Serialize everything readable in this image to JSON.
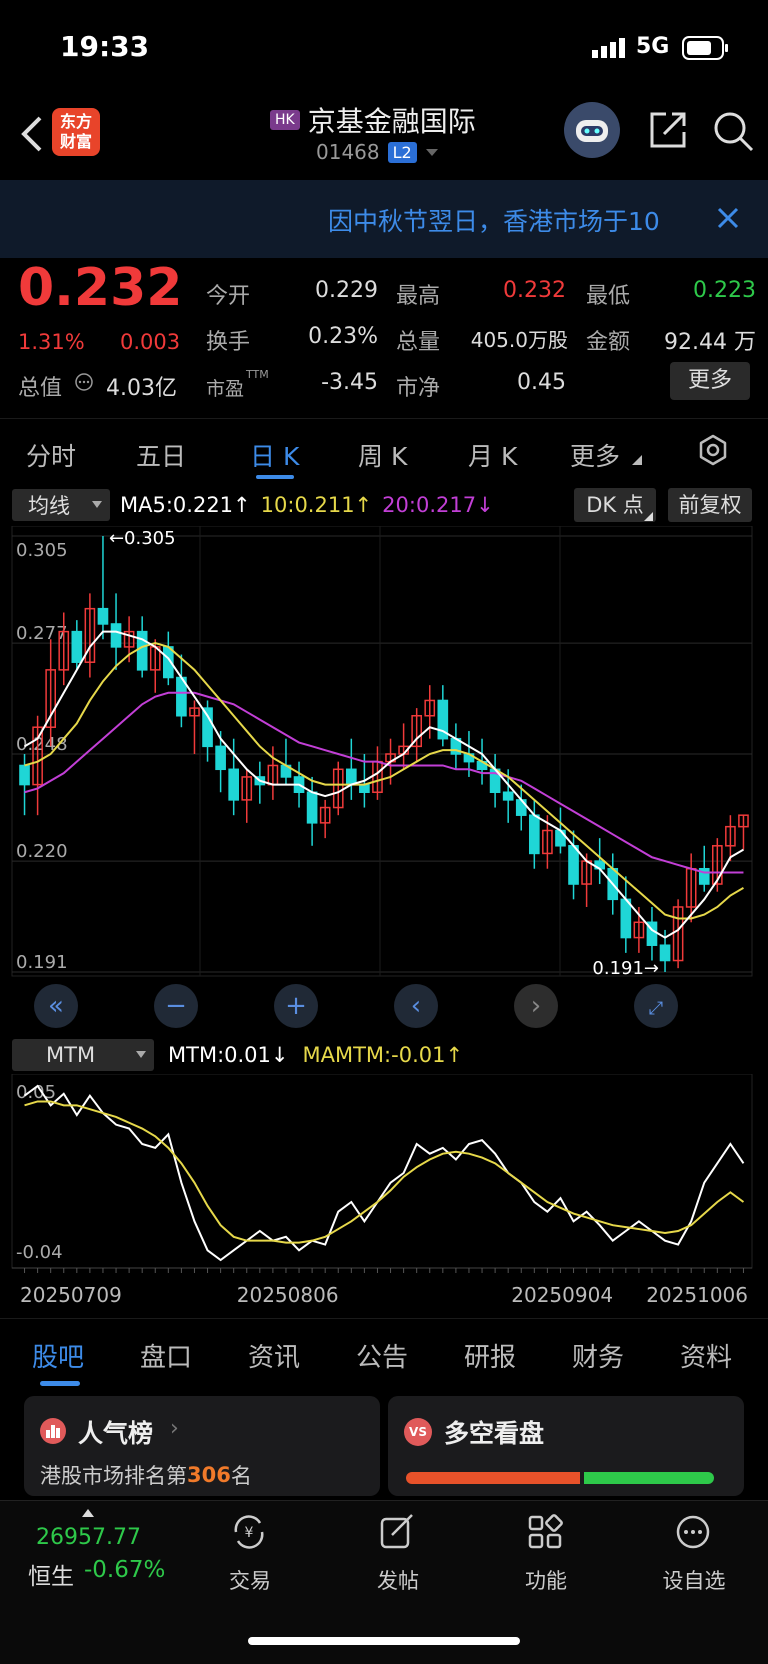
{
  "status_bar": {
    "time": "19:33",
    "network": "5G"
  },
  "header": {
    "app_logo": "东方\n财富",
    "market_badge": "HK",
    "stock_name": "京基金融国际",
    "stock_code": "01468",
    "level_badge": "L2"
  },
  "notice": {
    "text": "因中秋节翌日，香港市场于10"
  },
  "quote": {
    "price": "0.232",
    "change_pct": "1.31%",
    "change": "0.003",
    "fields": [
      {
        "label": "今开",
        "value": "0.229",
        "color": "#dddddd"
      },
      {
        "label": "最高",
        "value": "0.232",
        "color": "#f03a3a"
      },
      {
        "label": "最低",
        "value": "0.223",
        "color": "#2ec94a"
      },
      {
        "label": "换手",
        "value": "0.23%",
        "color": "#dddddd"
      },
      {
        "label": "总量",
        "value": "405.0万股",
        "color": "#dddddd"
      },
      {
        "label": "金额",
        "value": "92.44 万",
        "color": "#dddddd"
      },
      {
        "label": "总值",
        "value": "4.03亿",
        "color": "#dddddd"
      },
      {
        "label": "市盈",
        "value": "-3.45",
        "color": "#dddddd"
      },
      {
        "label": "市净",
        "value": "0.45",
        "color": "#dddddd"
      }
    ],
    "pe_suffix": "TTM",
    "more_button": "更多"
  },
  "chart_tabs": [
    "分时",
    "五日",
    "日 K",
    "周 K",
    "月 K",
    "更多"
  ],
  "active_chart_tab": 2,
  "indicator_bar": {
    "selector": "均线",
    "ma5": "MA5:0.221↑",
    "ma10": "10:0.211↑",
    "ma20": "20:0.217↓",
    "dk_button": "DK 点",
    "adjust_button": "前复权"
  },
  "mtm_bar": {
    "selector": "MTM",
    "mtm": "MTM:0.01↓",
    "mamtm": "MAMTM:-0.01↑"
  },
  "chart_data": [
    {
      "type": "candlestick",
      "y_ticks": [
        "0.305",
        "0.277",
        "0.248",
        "0.220",
        "0.191"
      ],
      "ylim": [
        0.191,
        0.305
      ],
      "annotations": [
        "←0.305",
        "0.191→"
      ],
      "x_labels": [
        "20250709",
        "20250806",
        "20250904",
        "20251006"
      ],
      "grid": true,
      "colors": {
        "up": "#f03a3a",
        "down": "#1fd6d6",
        "ma5": "#ffffff",
        "ma10": "#e6d84a",
        "ma20": "#c23fd6"
      },
      "candles": [
        [
          0.245,
          0.248,
          0.232,
          0.24
        ],
        [
          0.24,
          0.258,
          0.232,
          0.255
        ],
        [
          0.255,
          0.278,
          0.25,
          0.27
        ],
        [
          0.27,
          0.285,
          0.266,
          0.28
        ],
        [
          0.28,
          0.283,
          0.27,
          0.272
        ],
        [
          0.272,
          0.29,
          0.268,
          0.286
        ],
        [
          0.286,
          0.305,
          0.278,
          0.282
        ],
        [
          0.282,
          0.29,
          0.27,
          0.276
        ],
        [
          0.276,
          0.284,
          0.272,
          0.28
        ],
        [
          0.28,
          0.284,
          0.268,
          0.27
        ],
        [
          0.27,
          0.278,
          0.264,
          0.276
        ],
        [
          0.276,
          0.28,
          0.266,
          0.268
        ],
        [
          0.268,
          0.274,
          0.255,
          0.258
        ],
        [
          0.258,
          0.262,
          0.248,
          0.26
        ],
        [
          0.26,
          0.262,
          0.246,
          0.25
        ],
        [
          0.25,
          0.254,
          0.238,
          0.244
        ],
        [
          0.244,
          0.252,
          0.232,
          0.236
        ],
        [
          0.236,
          0.244,
          0.23,
          0.242
        ],
        [
          0.242,
          0.246,
          0.235,
          0.24
        ],
        [
          0.24,
          0.25,
          0.236,
          0.245
        ],
        [
          0.245,
          0.252,
          0.24,
          0.242
        ],
        [
          0.242,
          0.246,
          0.234,
          0.238
        ],
        [
          0.238,
          0.242,
          0.224,
          0.23
        ],
        [
          0.23,
          0.236,
          0.226,
          0.234
        ],
        [
          0.234,
          0.246,
          0.232,
          0.244
        ],
        [
          0.244,
          0.252,
          0.236,
          0.24
        ],
        [
          0.24,
          0.248,
          0.234,
          0.238
        ],
        [
          0.238,
          0.25,
          0.236,
          0.246
        ],
        [
          0.246,
          0.252,
          0.24,
          0.248
        ],
        [
          0.248,
          0.256,
          0.244,
          0.25
        ],
        [
          0.25,
          0.26,
          0.246,
          0.258
        ],
        [
          0.258,
          0.266,
          0.252,
          0.262
        ],
        [
          0.262,
          0.266,
          0.25,
          0.252
        ],
        [
          0.252,
          0.256,
          0.244,
          0.248
        ],
        [
          0.248,
          0.254,
          0.242,
          0.246
        ],
        [
          0.246,
          0.252,
          0.24,
          0.244
        ],
        [
          0.244,
          0.248,
          0.234,
          0.238
        ],
        [
          0.238,
          0.244,
          0.23,
          0.236
        ],
        [
          0.236,
          0.24,
          0.228,
          0.232
        ],
        [
          0.232,
          0.236,
          0.218,
          0.222
        ],
        [
          0.222,
          0.232,
          0.218,
          0.228
        ],
        [
          0.228,
          0.234,
          0.222,
          0.224
        ],
        [
          0.224,
          0.228,
          0.21,
          0.214
        ],
        [
          0.214,
          0.222,
          0.208,
          0.22
        ],
        [
          0.22,
          0.226,
          0.214,
          0.218
        ],
        [
          0.218,
          0.222,
          0.206,
          0.21
        ],
        [
          0.21,
          0.216,
          0.196,
          0.2
        ],
        [
          0.2,
          0.208,
          0.196,
          0.204
        ],
        [
          0.204,
          0.208,
          0.194,
          0.198
        ],
        [
          0.198,
          0.202,
          0.191,
          0.194
        ],
        [
          0.194,
          0.21,
          0.192,
          0.208
        ],
        [
          0.208,
          0.222,
          0.204,
          0.218
        ],
        [
          0.218,
          0.224,
          0.212,
          0.214
        ],
        [
          0.214,
          0.226,
          0.212,
          0.224
        ],
        [
          0.224,
          0.232,
          0.22,
          0.229
        ],
        [
          0.229,
          0.232,
          0.223,
          0.232
        ]
      ],
      "ma5": [
        0.25,
        0.252,
        0.258,
        0.264,
        0.27,
        0.276,
        0.28,
        0.28,
        0.279,
        0.278,
        0.276,
        0.273,
        0.268,
        0.263,
        0.258,
        0.252,
        0.248,
        0.244,
        0.241,
        0.24,
        0.24,
        0.24,
        0.238,
        0.237,
        0.238,
        0.24,
        0.241,
        0.243,
        0.246,
        0.248,
        0.252,
        0.255,
        0.254,
        0.252,
        0.25,
        0.248,
        0.244,
        0.24,
        0.236,
        0.232,
        0.23,
        0.228,
        0.224,
        0.22,
        0.218,
        0.214,
        0.21,
        0.206,
        0.202,
        0.2,
        0.202,
        0.206,
        0.21,
        0.215,
        0.221,
        0.223
      ],
      "ma10": [
        0.245,
        0.246,
        0.248,
        0.252,
        0.256,
        0.262,
        0.267,
        0.271,
        0.274,
        0.276,
        0.277,
        0.276,
        0.273,
        0.27,
        0.266,
        0.262,
        0.258,
        0.254,
        0.25,
        0.247,
        0.245,
        0.243,
        0.241,
        0.24,
        0.24,
        0.24,
        0.24,
        0.241,
        0.242,
        0.244,
        0.246,
        0.248,
        0.249,
        0.249,
        0.248,
        0.246,
        0.244,
        0.242,
        0.239,
        0.236,
        0.233,
        0.23,
        0.227,
        0.224,
        0.221,
        0.218,
        0.215,
        0.212,
        0.209,
        0.206,
        0.205,
        0.205,
        0.206,
        0.208,
        0.211,
        0.213
      ],
      "ma20": [
        0.238,
        0.239,
        0.241,
        0.243,
        0.246,
        0.249,
        0.252,
        0.255,
        0.258,
        0.261,
        0.263,
        0.264,
        0.264,
        0.264,
        0.263,
        0.262,
        0.261,
        0.259,
        0.257,
        0.255,
        0.253,
        0.251,
        0.25,
        0.249,
        0.248,
        0.247,
        0.246,
        0.246,
        0.245,
        0.245,
        0.245,
        0.245,
        0.245,
        0.244,
        0.244,
        0.243,
        0.243,
        0.242,
        0.241,
        0.239,
        0.237,
        0.235,
        0.233,
        0.231,
        0.229,
        0.227,
        0.225,
        0.223,
        0.221,
        0.22,
        0.219,
        0.218,
        0.217,
        0.217,
        0.217,
        0.217
      ]
    },
    {
      "type": "line",
      "y_ticks": [
        "0.05",
        "-0.04"
      ],
      "ylim": [
        -0.04,
        0.05
      ],
      "series": [
        {
          "name": "MTM",
          "color": "#ffffff",
          "values": [
            0.045,
            0.05,
            0.04,
            0.046,
            0.035,
            0.045,
            0.036,
            0.03,
            0.028,
            0.02,
            0.018,
            0.025,
            0.0,
            -0.02,
            -0.035,
            -0.04,
            -0.035,
            -0.03,
            -0.025,
            -0.03,
            -0.028,
            -0.035,
            -0.03,
            -0.032,
            -0.015,
            -0.01,
            -0.02,
            -0.01,
            0.0,
            0.005,
            0.02,
            0.015,
            0.018,
            0.012,
            0.02,
            0.022,
            0.015,
            0.005,
            0.0,
            -0.01,
            -0.015,
            -0.008,
            -0.02,
            -0.015,
            -0.022,
            -0.03,
            -0.025,
            -0.02,
            -0.025,
            -0.03,
            -0.032,
            -0.02,
            0.0,
            0.01,
            0.02,
            0.01
          ]
        },
        {
          "name": "MAMTM",
          "color": "#e6d84a",
          "values": [
            0.04,
            0.042,
            0.042,
            0.04,
            0.04,
            0.038,
            0.036,
            0.034,
            0.031,
            0.028,
            0.024,
            0.018,
            0.01,
            0.0,
            -0.012,
            -0.022,
            -0.028,
            -0.03,
            -0.03,
            -0.03,
            -0.031,
            -0.031,
            -0.03,
            -0.028,
            -0.024,
            -0.02,
            -0.015,
            -0.01,
            -0.004,
            0.003,
            0.008,
            0.012,
            0.015,
            0.016,
            0.015,
            0.013,
            0.01,
            0.005,
            0.0,
            -0.005,
            -0.01,
            -0.013,
            -0.016,
            -0.018,
            -0.02,
            -0.022,
            -0.023,
            -0.024,
            -0.025,
            -0.026,
            -0.025,
            -0.022,
            -0.016,
            -0.01,
            -0.005,
            -0.01
          ]
        }
      ]
    }
  ],
  "bottom_tabs": [
    "股吧",
    "盘口",
    "资讯",
    "公告",
    "研报",
    "财务",
    "资料"
  ],
  "active_bottom_tab": 0,
  "cards": {
    "popularity": {
      "title": "人气榜",
      "rank_prefix": "港股市场排名第",
      "rank": "306",
      "rank_suffix": "名"
    },
    "bullbear": {
      "title": "多空看盘",
      "badge": "VS"
    }
  },
  "bottom_nav": {
    "index_value": "26957.77",
    "index_name": "恒生",
    "index_change": "-0.67%",
    "items": [
      "交易",
      "发帖",
      "功能",
      "设自选"
    ]
  }
}
